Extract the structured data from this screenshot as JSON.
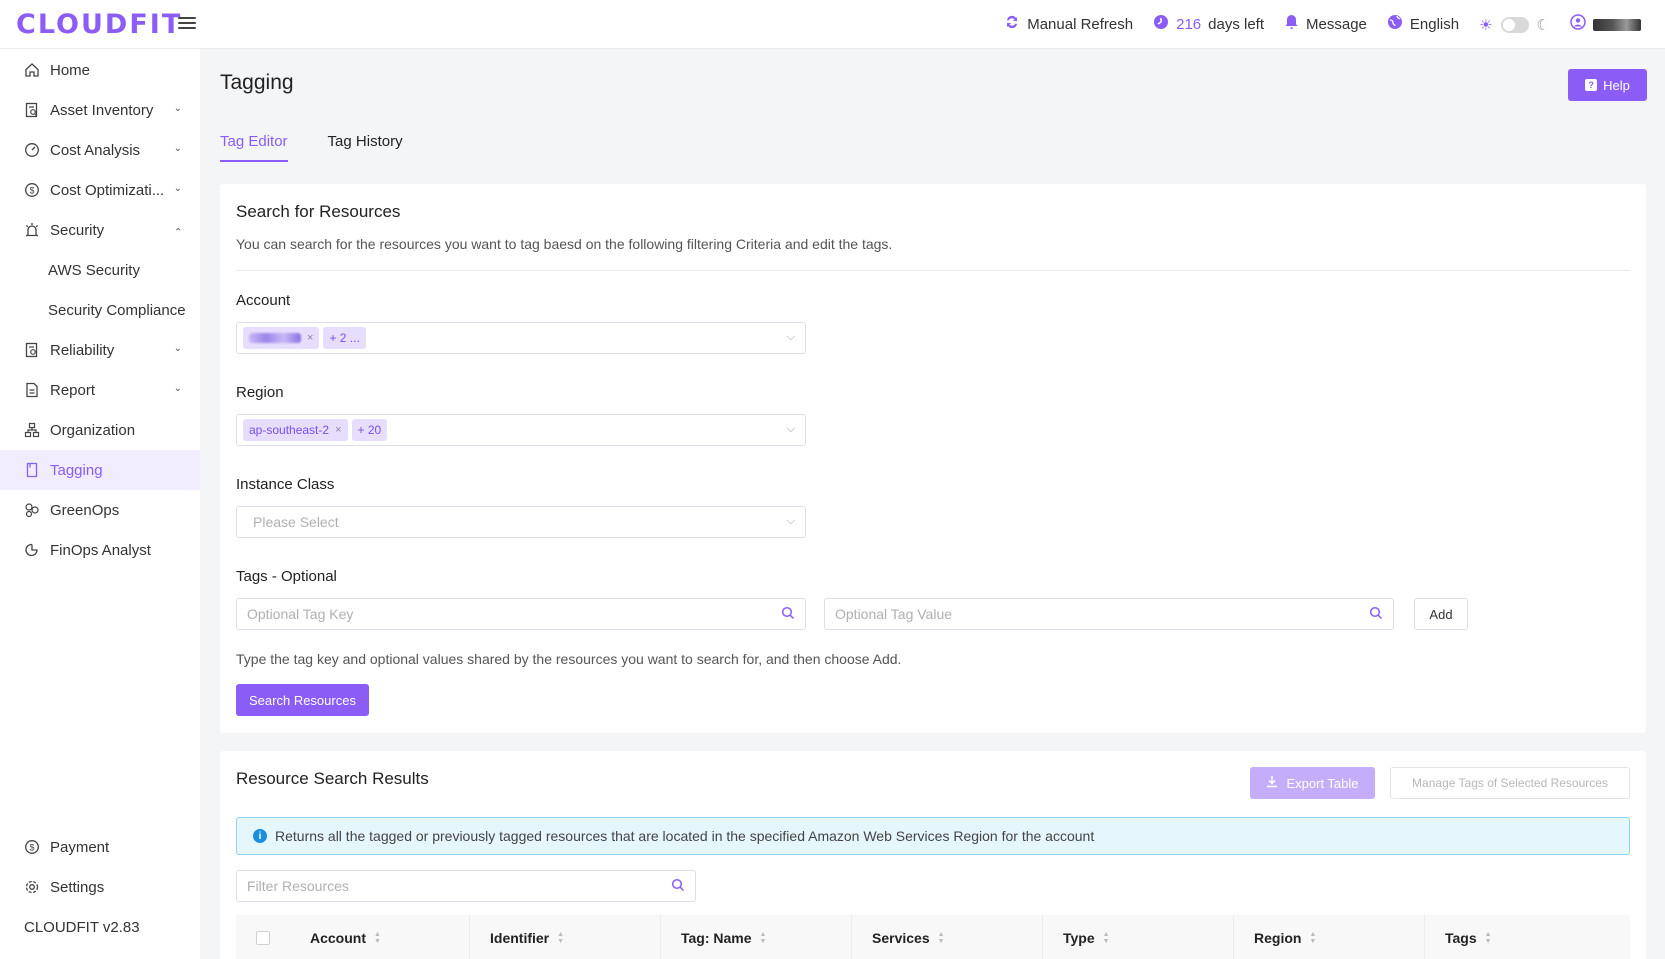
{
  "header": {
    "logo": "CLOUDFIT",
    "manual_refresh": "Manual Refresh",
    "days_left_num": "216",
    "days_left_text": "days left",
    "message": "Message",
    "language": "English"
  },
  "sidebar": {
    "items": [
      {
        "label": "Home",
        "icon": "home-icon"
      },
      {
        "label": "Asset Inventory",
        "icon": "inventory-icon"
      },
      {
        "label": "Cost Analysis",
        "icon": "gauge-icon"
      },
      {
        "label": "Cost Optimizati...",
        "icon": "dollar-icon"
      },
      {
        "label": "Security",
        "icon": "alarm-icon"
      },
      {
        "label": "AWS Security"
      },
      {
        "label": "Security Compliance"
      },
      {
        "label": "Reliability",
        "icon": "reliability-icon"
      },
      {
        "label": "Report",
        "icon": "report-icon"
      },
      {
        "label": "Organization",
        "icon": "org-icon"
      },
      {
        "label": "Tagging",
        "icon": "tag-icon"
      },
      {
        "label": "GreenOps",
        "icon": "greenops-icon"
      },
      {
        "label": "FinOps Analyst",
        "icon": "finops-icon"
      }
    ],
    "payment": "Payment",
    "settings": "Settings",
    "version": "CLOUDFIT v2.83"
  },
  "page": {
    "title": "Tagging",
    "help": "Help",
    "tabs": [
      "Tag Editor",
      "Tag History"
    ]
  },
  "search": {
    "title": "Search for Resources",
    "desc": "You can search for the resources you want to tag baesd on the following filtering Criteria and edit the tags.",
    "account_label": "Account",
    "account_more": "+ 2 ...",
    "region_label": "Region",
    "region_chip": "ap-southeast-2",
    "region_more": "+ 20",
    "instance_label": "Instance Class",
    "instance_placeholder": "Please Select",
    "tags_label": "Tags - Optional",
    "tag_key_placeholder": "Optional Tag Key",
    "tag_value_placeholder": "Optional Tag Value",
    "add": "Add",
    "hint": "Type the tag key and optional values shared by the resources you want to search for, and then choose Add.",
    "search_button": "Search Resources"
  },
  "results": {
    "title": "Resource Search Results",
    "export": "Export Table",
    "manage": "Manage Tags of Selected Resources",
    "info": "Returns all the tagged or previously tagged resources that are located in the specified Amazon Web Services Region for the account",
    "filter_placeholder": "Filter Resources",
    "columns": [
      "Account",
      "Identifier",
      "Tag: Name",
      "Services",
      "Type",
      "Region",
      "Tags"
    ]
  },
  "colors": {
    "accent": "#8b5cf6",
    "info_bg": "#e6f6fd",
    "info_border": "#8fd3f3"
  }
}
